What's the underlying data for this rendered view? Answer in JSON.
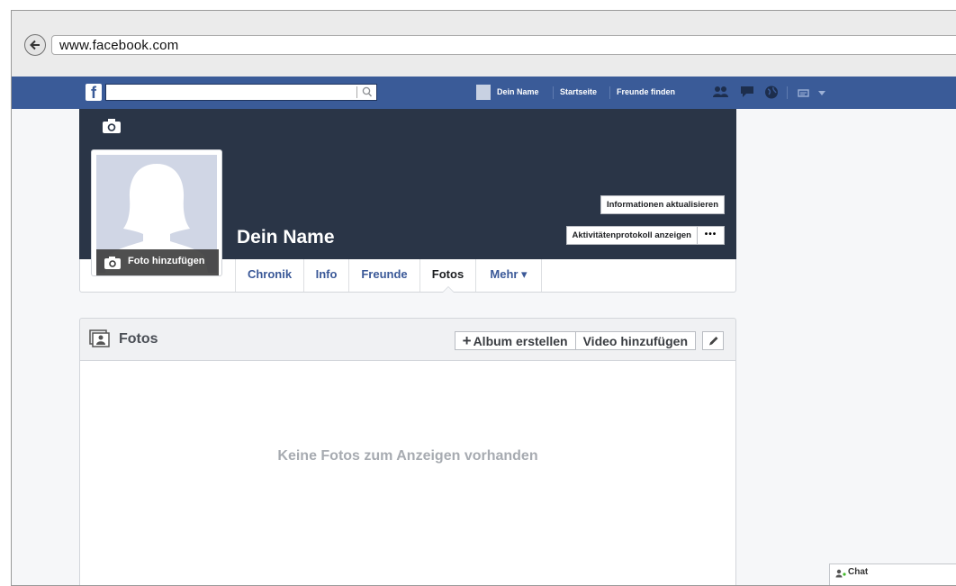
{
  "browser": {
    "url": "www.facebook.com"
  },
  "topbar": {
    "brand": "f",
    "nav": {
      "profile_name": "Dein Name",
      "home": "Startseite",
      "find_friends": "Freunde finden"
    },
    "icons": [
      "friend-requests-icon",
      "messages-icon",
      "notifications-globe-icon",
      "privacy-icon",
      "settings-arrow-icon"
    ],
    "bar_color": "#3a5b98"
  },
  "profile": {
    "name": "Dein Name",
    "add_photo_label": "Foto hinzufügen",
    "update_info_label": "Informationen aktualisieren",
    "activity_log_label": "Aktivitätenprotokoll anzeigen",
    "more_dots": "•••",
    "cover_color": "#2a3547"
  },
  "tabs": [
    {
      "label": "Chronik"
    },
    {
      "label": "Info"
    },
    {
      "label": "Freunde"
    },
    {
      "label": "Fotos",
      "active": true
    },
    {
      "label": "Mehr ▾"
    }
  ],
  "photos": {
    "title": "Fotos",
    "create_album_label": "Album erstellen",
    "add_video_label": "Video hinzufügen",
    "empty_message": "Keine Fotos zum Anzeigen vorhanden"
  },
  "chat": {
    "label": "Chat"
  }
}
